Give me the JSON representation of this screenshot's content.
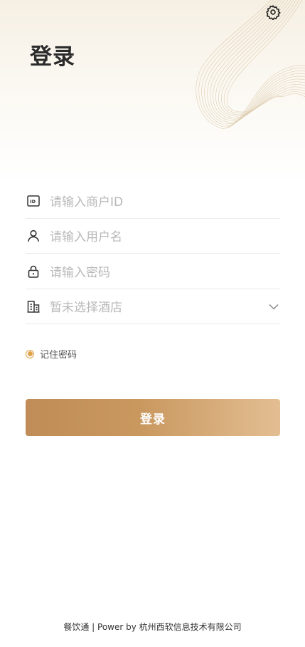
{
  "header": {
    "title": "登录"
  },
  "icons": {
    "settings": "gear-icon",
    "merchant": "id-card-icon",
    "user": "user-icon",
    "password": "lock-icon",
    "hotel": "building-icon",
    "dropdown": "chevron-down-icon"
  },
  "form": {
    "merchant_placeholder": "请输入商户ID",
    "username_placeholder": "请输入用户名",
    "password_placeholder": "请输入密码",
    "hotel_placeholder": "暂未选择酒店",
    "remember_label": "记住密码",
    "remember_checked": true
  },
  "actions": {
    "login_label": "登录"
  },
  "footer": {
    "text": "餐饮通 | Power by 杭州西软信息技术有限公司"
  },
  "colors": {
    "accent": "#e0a24a",
    "button_start": "#c08c57",
    "button_end": "#e3be92"
  }
}
